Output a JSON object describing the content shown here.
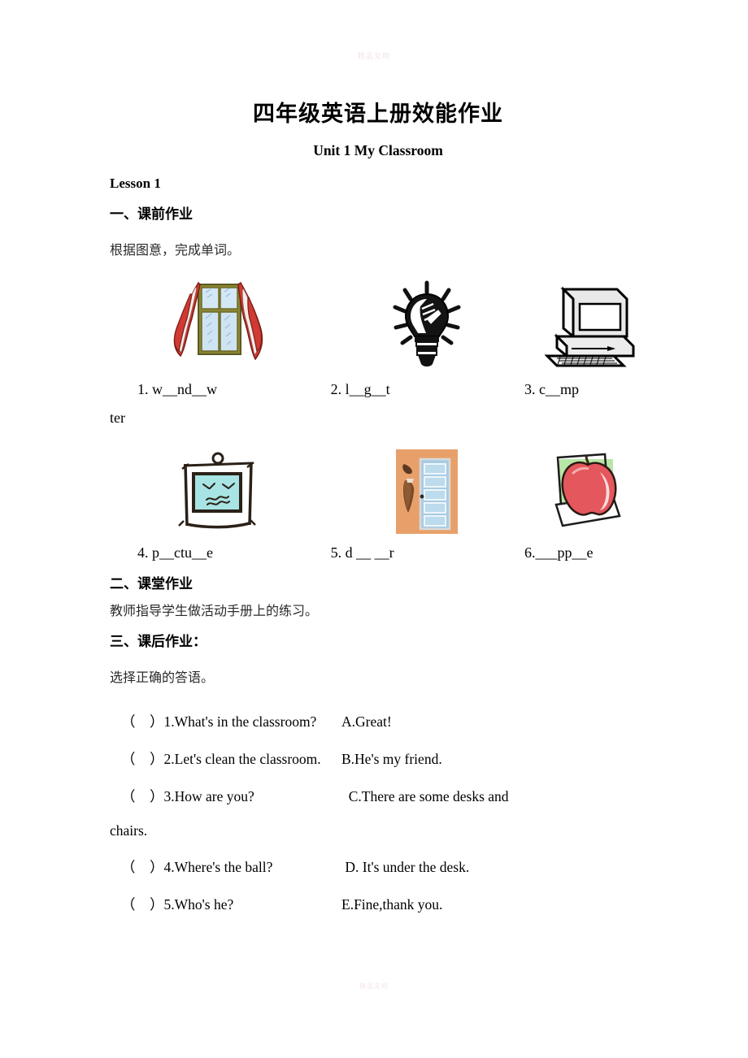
{
  "watermarks": {
    "top": "精品文档",
    "bottom": "精品文档"
  },
  "document": {
    "title": "四年级英语上册效能作业",
    "subtitle": "Unit 1    My    Classroom",
    "lesson": "Lesson 1"
  },
  "sections": {
    "pre_class": {
      "heading": "一、课前作业",
      "instruction": "根据图意，完成单词。"
    },
    "in_class": {
      "heading": "二、课堂作业",
      "instruction": "教师指导学生做活动手册上的练习。"
    },
    "after_class": {
      "heading": "三、课后作业：",
      "instruction": "选择正确的答语。"
    }
  },
  "word_exercise": {
    "row1": {
      "pictures": [
        "window-picture",
        "lightbulb-picture",
        "computer-picture"
      ],
      "items": [
        "1. w__nd__w",
        "2. l__g__t",
        "3. c__mp"
      ],
      "wrapped_tail": "ter"
    },
    "row2": {
      "pictures": [
        "picture-frame-picture",
        "door-picture",
        "apple-picture"
      ],
      "items": [
        "4. p__ctu__e",
        "5. d __  __r",
        "6.___pp__e"
      ]
    }
  },
  "matching_exercise": {
    "rows": [
      {
        "question": "（    ）1.What's in the classroom?",
        "answer": "A.Great!"
      },
      {
        "question": "（    ）2.Let's clean the classroom.",
        "answer": "B.He's my friend."
      },
      {
        "question": "（    ）3.How are you?",
        "answer": "  C.There are some desks and"
      },
      {
        "question": "（    ）4.Where's the ball?",
        "answer": " D. It's under the desk."
      },
      {
        "question": "（    ）5.Who's he?",
        "answer": "E.Fine,thank you."
      }
    ],
    "wrapped_tail": "chairs."
  },
  "colors": {
    "window_frame": "#8a8534",
    "window_glass": "#cfe4f2",
    "curtain": "#cf3a32",
    "door_wall": "#e8a06a",
    "door_panel": "#a8cbe2",
    "apple": "#e4575c",
    "apple_backdrop": "#b8e6a8",
    "frame_canvas": "#a8e4e4"
  }
}
